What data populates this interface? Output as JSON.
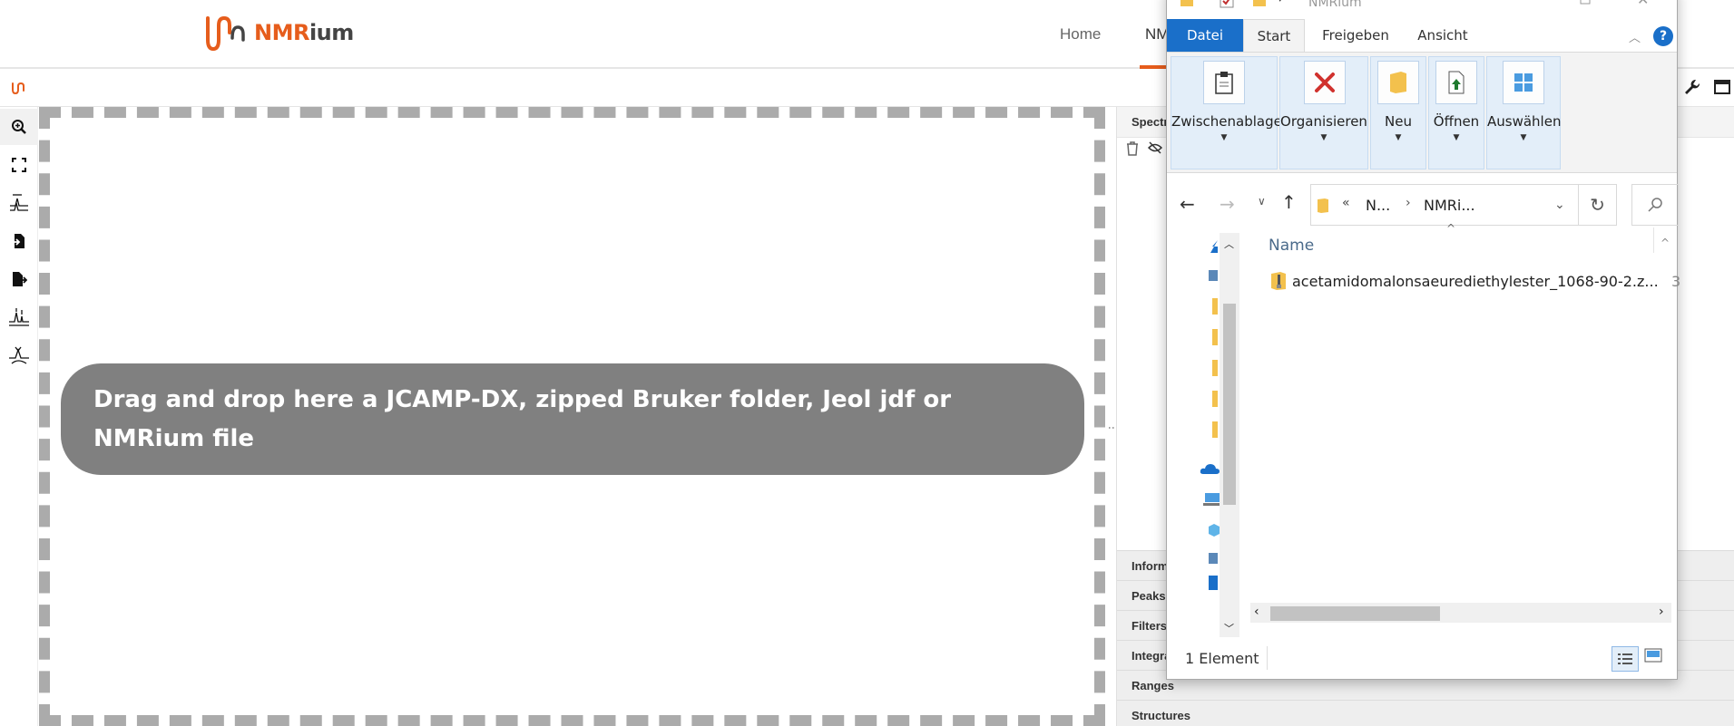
{
  "app": {
    "brand_nmr": "NMR",
    "brand_ium": "ium",
    "accent_color": "#e65d1c"
  },
  "nav": {
    "home": "Home",
    "nmrium_partial": "NM"
  },
  "tools": [
    "zoom-icon",
    "full-view-icon",
    "spectra-stack-icon",
    "import-icon",
    "export-icon",
    "peak-picking-icon",
    "baseline-icon"
  ],
  "dropzone": {
    "message": "Drag and drop here a JCAMP-DX, zipped Bruker folder, Jeol jdf or NMRium file"
  },
  "right_panel": {
    "header": "Spectr",
    "accordion": [
      "Inform",
      "Peaks",
      "Filters",
      "Integra",
      "Ranges",
      "Structures"
    ]
  },
  "explorer": {
    "title": "NMRium",
    "tabs": {
      "file": "Datei",
      "start": "Start",
      "share": "Freigeben",
      "view": "Ansicht"
    },
    "ribbon": {
      "clipboard": "Zwischenablage",
      "organize": "Organisieren",
      "new": "Neu",
      "open": "Öffnen",
      "select": "Auswählen"
    },
    "address": {
      "prefix": "«",
      "crumb1": "N...",
      "crumb2": "NMRi..."
    },
    "column_name": "Name",
    "file_name": "acetamidomalonsaeurediethylester_1068-90-2.z...",
    "file_size_partial": "3",
    "status": "1 Element",
    "file_accent": "#1a6fc9"
  }
}
